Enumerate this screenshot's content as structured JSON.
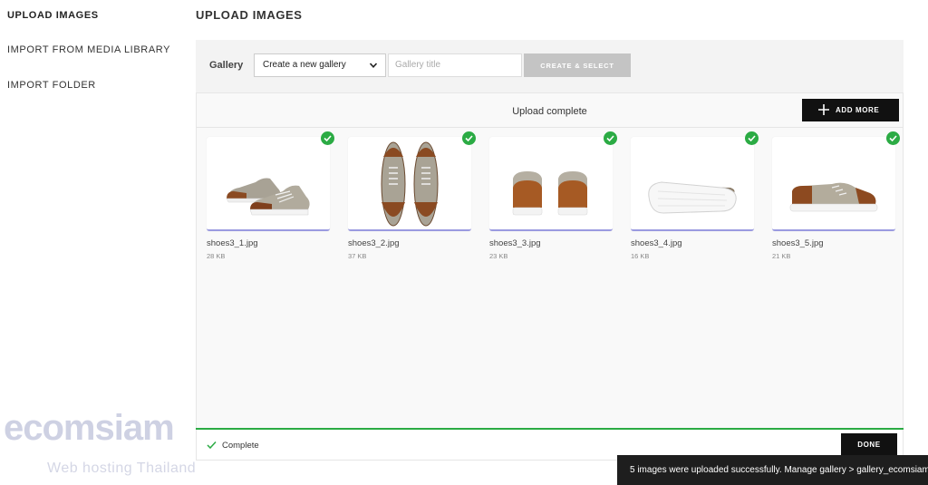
{
  "sidebar": {
    "items": [
      {
        "label": "UPLOAD IMAGES"
      },
      {
        "label": "IMPORT FROM MEDIA LIBRARY"
      },
      {
        "label": "IMPORT FOLDER"
      }
    ]
  },
  "page": {
    "title": "UPLOAD IMAGES"
  },
  "gallery": {
    "label": "Gallery",
    "select_value": "Create a new gallery",
    "title_placeholder": "Gallery title",
    "create_button": "CREATE & SELECT"
  },
  "upload": {
    "status": "Upload complete",
    "add_more": "ADD MORE",
    "files": [
      {
        "name": "shoes3_1.jpg",
        "size": "28 KB"
      },
      {
        "name": "shoes3_2.jpg",
        "size": "37 KB"
      },
      {
        "name": "shoes3_3.jpg",
        "size": "23 KB"
      },
      {
        "name": "shoes3_4.jpg",
        "size": "16 KB"
      },
      {
        "name": "shoes3_5.jpg",
        "size": "21 KB"
      }
    ]
  },
  "footer": {
    "status": "Complete",
    "done": "DONE"
  },
  "toast": {
    "message": "5 images were uploaded successfully. Manage gallery > gallery_ecomsiam"
  },
  "watermark": {
    "brand": "ecomsiam",
    "tagline": "Web hosting Thailand"
  },
  "colors": {
    "success": "#2bab44",
    "dark": "#111111",
    "panel": "#f3f3f3"
  }
}
